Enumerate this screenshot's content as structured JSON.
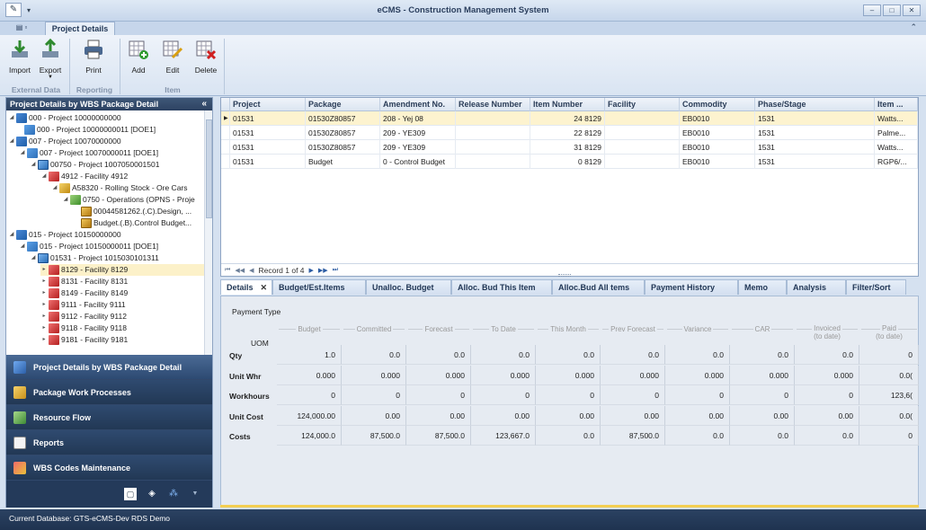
{
  "window": {
    "title": "eCMS - Construction Management System"
  },
  "ribbon": {
    "tab": "Project Details",
    "buttons": {
      "import": "Import",
      "export": "Export",
      "print": "Print",
      "add": "Add",
      "edit": "Edit",
      "delete": "Delete"
    },
    "groups": {
      "external": "External Data",
      "reporting": "Reporting",
      "item": "Item"
    }
  },
  "sidebar": {
    "title": "Project Details by WBS Package Detail",
    "tree": [
      "000 - Project 10000000000",
      "000 - Project 10000000011 [DOE1]",
      "007 - Project 10070000000",
      "007 - Project 10070000011 [DOE1]",
      "00750 - Project 1007050001501",
      "4912 - Facility 4912",
      "A58320 - Rolling Stock - Ore Cars",
      "0750 - Operations  (OPNS - Proje",
      "00044581262.(.C).Design, ...",
      "Budget.(.B).Control Budget...",
      "015 - Project 10150000000",
      "015 - Project 10150000011 [DOE1]",
      "01531 - Project 1015030101311",
      "8129 - Facility 8129",
      "8131 - Facility 8131",
      "8149 - Facility 8149",
      "9111 - Facility 9111",
      "9112 - Facility 9112",
      "9118 - Facility 9118",
      "9181 - Facility 9181"
    ],
    "nav": [
      "Project Details by WBS Package Detail",
      "Package Work Processes",
      "Resource Flow",
      "Reports",
      "WBS Codes Maintenance"
    ]
  },
  "grid": {
    "columns": [
      "Project",
      "Package",
      "Amendment No.",
      "Release Number",
      "Item Number",
      "Facility",
      "Commodity",
      "Phase/Stage",
      "Item ..."
    ],
    "rows": [
      [
        "01531",
        "01530Z80857",
        "208 - Yej 08",
        "",
        "24",
        "8129",
        "EB0010",
        "1531",
        "Watts..."
      ],
      [
        "01531",
        "01530Z80857",
        "209 - YE309",
        "",
        "22",
        "8129",
        "EB0010",
        "1531",
        "Palme..."
      ],
      [
        "01531",
        "01530Z80857",
        "209 - YE309",
        "",
        "31",
        "8129",
        "EB0010",
        "1531",
        "Watts..."
      ],
      [
        "01531",
        "Budget",
        "0 - Control Budget",
        "",
        "0",
        "8129",
        "EB0010",
        "1531",
        "RGP6/..."
      ]
    ],
    "record_text": "Record 1 of 4"
  },
  "detail_tabs": [
    "Details",
    "Budget/Est.Items",
    "Unalloc. Budget",
    "Alloc. Bud This Item",
    "Alloc.Bud All tems",
    "Payment History",
    "Memo",
    "Analysis",
    "Filter/Sort"
  ],
  "details": {
    "payment_type": "Payment Type",
    "uom": "UOM",
    "headers": [
      "Budget",
      "Committed",
      "Forecast",
      "To Date",
      "This Month",
      "Prev Forecast",
      "Variance",
      "CAR",
      "Invoiced\n(to date)",
      "Paid\n(to date)"
    ],
    "header_top": [
      "",
      "",
      "",
      "",
      "",
      "",
      "",
      "",
      "Invoiced",
      "Paid"
    ],
    "header_bottom": [
      "",
      "",
      "",
      "",
      "",
      "",
      "",
      "",
      "(to date)",
      "(to date)"
    ],
    "header_single": [
      "Budget",
      "Committed",
      "Forecast",
      "To Date",
      "This Month",
      "Prev Forecast",
      "Variance",
      "CAR",
      "",
      ""
    ],
    "rows": [
      {
        "label": "Qty",
        "values": [
          "1.0",
          "0.0",
          "0.0",
          "0.0",
          "0.0",
          "0.0",
          "0.0",
          "0.0",
          "0.0",
          "0"
        ]
      },
      {
        "label": "Unit Whr",
        "values": [
          "0.000",
          "0.000",
          "0.000",
          "0.000",
          "0.000",
          "0.000",
          "0.000",
          "0.000",
          "0.000",
          "0.0("
        ]
      },
      {
        "label": "Workhours",
        "values": [
          "0",
          "0",
          "0",
          "0",
          "0",
          "0",
          "0",
          "0",
          "0",
          "123,6("
        ]
      },
      {
        "label": "Unit Cost",
        "values": [
          "124,000.00",
          "0.00",
          "0.00",
          "0.00",
          "0.00",
          "0.00",
          "0.00",
          "0.00",
          "0.00",
          "0.0("
        ]
      },
      {
        "label": "Costs",
        "values": [
          "124,000.0",
          "87,500.0",
          "87,500.0",
          "123,667.0",
          "0.0",
          "87,500.0",
          "0.0",
          "0.0",
          "0.0",
          "0"
        ]
      }
    ]
  },
  "status": {
    "text": "Current Database: GTS-eCMS-Dev  RDS Demo"
  }
}
